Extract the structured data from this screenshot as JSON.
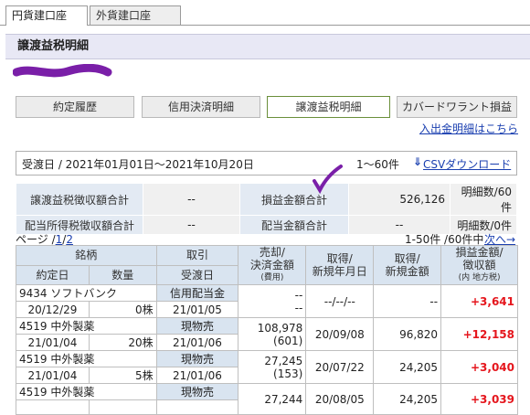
{
  "tabs": [
    {
      "label": "円貨建口座",
      "active": true
    },
    {
      "label": "外貨建口座",
      "active": false
    }
  ],
  "page_title": "譲渡益税明細",
  "nav": [
    {
      "label": "約定履歴",
      "active": false
    },
    {
      "label": "信用決済明細",
      "active": false
    },
    {
      "label": "譲渡益税明細",
      "active": true
    },
    {
      "label": "カバードワラント損益",
      "active": false
    }
  ],
  "deposit_link": "入出金明細はこちら",
  "period": {
    "text": "受渡日 / 2021年01月01日〜2021年10月20日",
    "range": "1〜60件",
    "csv_icon": "download-arrow-icon",
    "csv_label": "CSVダウンロード"
  },
  "summary": {
    "row1": {
      "label1": "譲渡益税徴収額合計",
      "val1": "--",
      "label2": "損益金額合計",
      "val2": "526,126",
      "count": "明細数/60件"
    },
    "row2": {
      "label1": "配当所得税徴収額合計",
      "val1": "--",
      "label2": "配当金額合計",
      "val2": "--",
      "count": "明細数/0件"
    }
  },
  "pager": {
    "prefix": "ページ /",
    "page": "1",
    "sep": "/",
    "total": "2",
    "count_text": "1-50件 /60件中",
    "next": "次へ→"
  },
  "table_headers": {
    "meigara": "銘柄",
    "torihiki": "取引",
    "baikyaku": [
      "売却/",
      "決済金額"
    ],
    "baikyaku_sub": "(費用)",
    "shutoku_date": [
      "取得/",
      "新規年月日"
    ],
    "shutoku_amount": [
      "取得/",
      "新規金額"
    ],
    "soneki": [
      "損益金額/",
      "徴収額"
    ],
    "soneki_sub": "(内 地方税)",
    "yakujo": "約定日",
    "suryo": "数量",
    "ukewatashi": "受渡日"
  },
  "rows": [
    {
      "code_name": "9434 ソフトバンク",
      "torihiki": "信用配当金",
      "yakujo": "20/12/29",
      "suryo": "0株",
      "ukewatashi": "21/01/05",
      "baikyaku": "--",
      "hiyo": "--",
      "shutoku_date": "--/--/--",
      "shutoku_amount": "--",
      "soneki": "+3,641"
    },
    {
      "code_name": "4519 中外製薬",
      "torihiki": "現物売",
      "yakujo": "21/01/04",
      "suryo": "20株",
      "ukewatashi": "21/01/06",
      "baikyaku": "108,978",
      "hiyo": "(601)",
      "shutoku_date": "20/09/08",
      "shutoku_amount": "96,820",
      "soneki": "+12,158"
    },
    {
      "code_name": "4519 中外製薬",
      "torihiki": "現物売",
      "yakujo": "21/01/04",
      "suryo": "5株",
      "ukewatashi": "21/01/06",
      "baikyaku": "27,245",
      "hiyo": "(153)",
      "shutoku_date": "20/07/22",
      "shutoku_amount": "24,205",
      "soneki": "+3,040"
    },
    {
      "code_name": "4519 中外製薬",
      "torihiki": "現物売",
      "yakujo": "",
      "suryo": "",
      "ukewatashi": "",
      "baikyaku": "27,244",
      "hiyo": "",
      "shutoku_date": "20/08/05",
      "shutoku_amount": "24,205",
      "soneki": "+3,039"
    }
  ],
  "colors": {
    "accent_link": "#1a3fb0",
    "gain": "#e5161d",
    "header_bg": "#d9e4f0",
    "title_bg": "#e8e8f5",
    "redaction": "#7a1fa8"
  }
}
